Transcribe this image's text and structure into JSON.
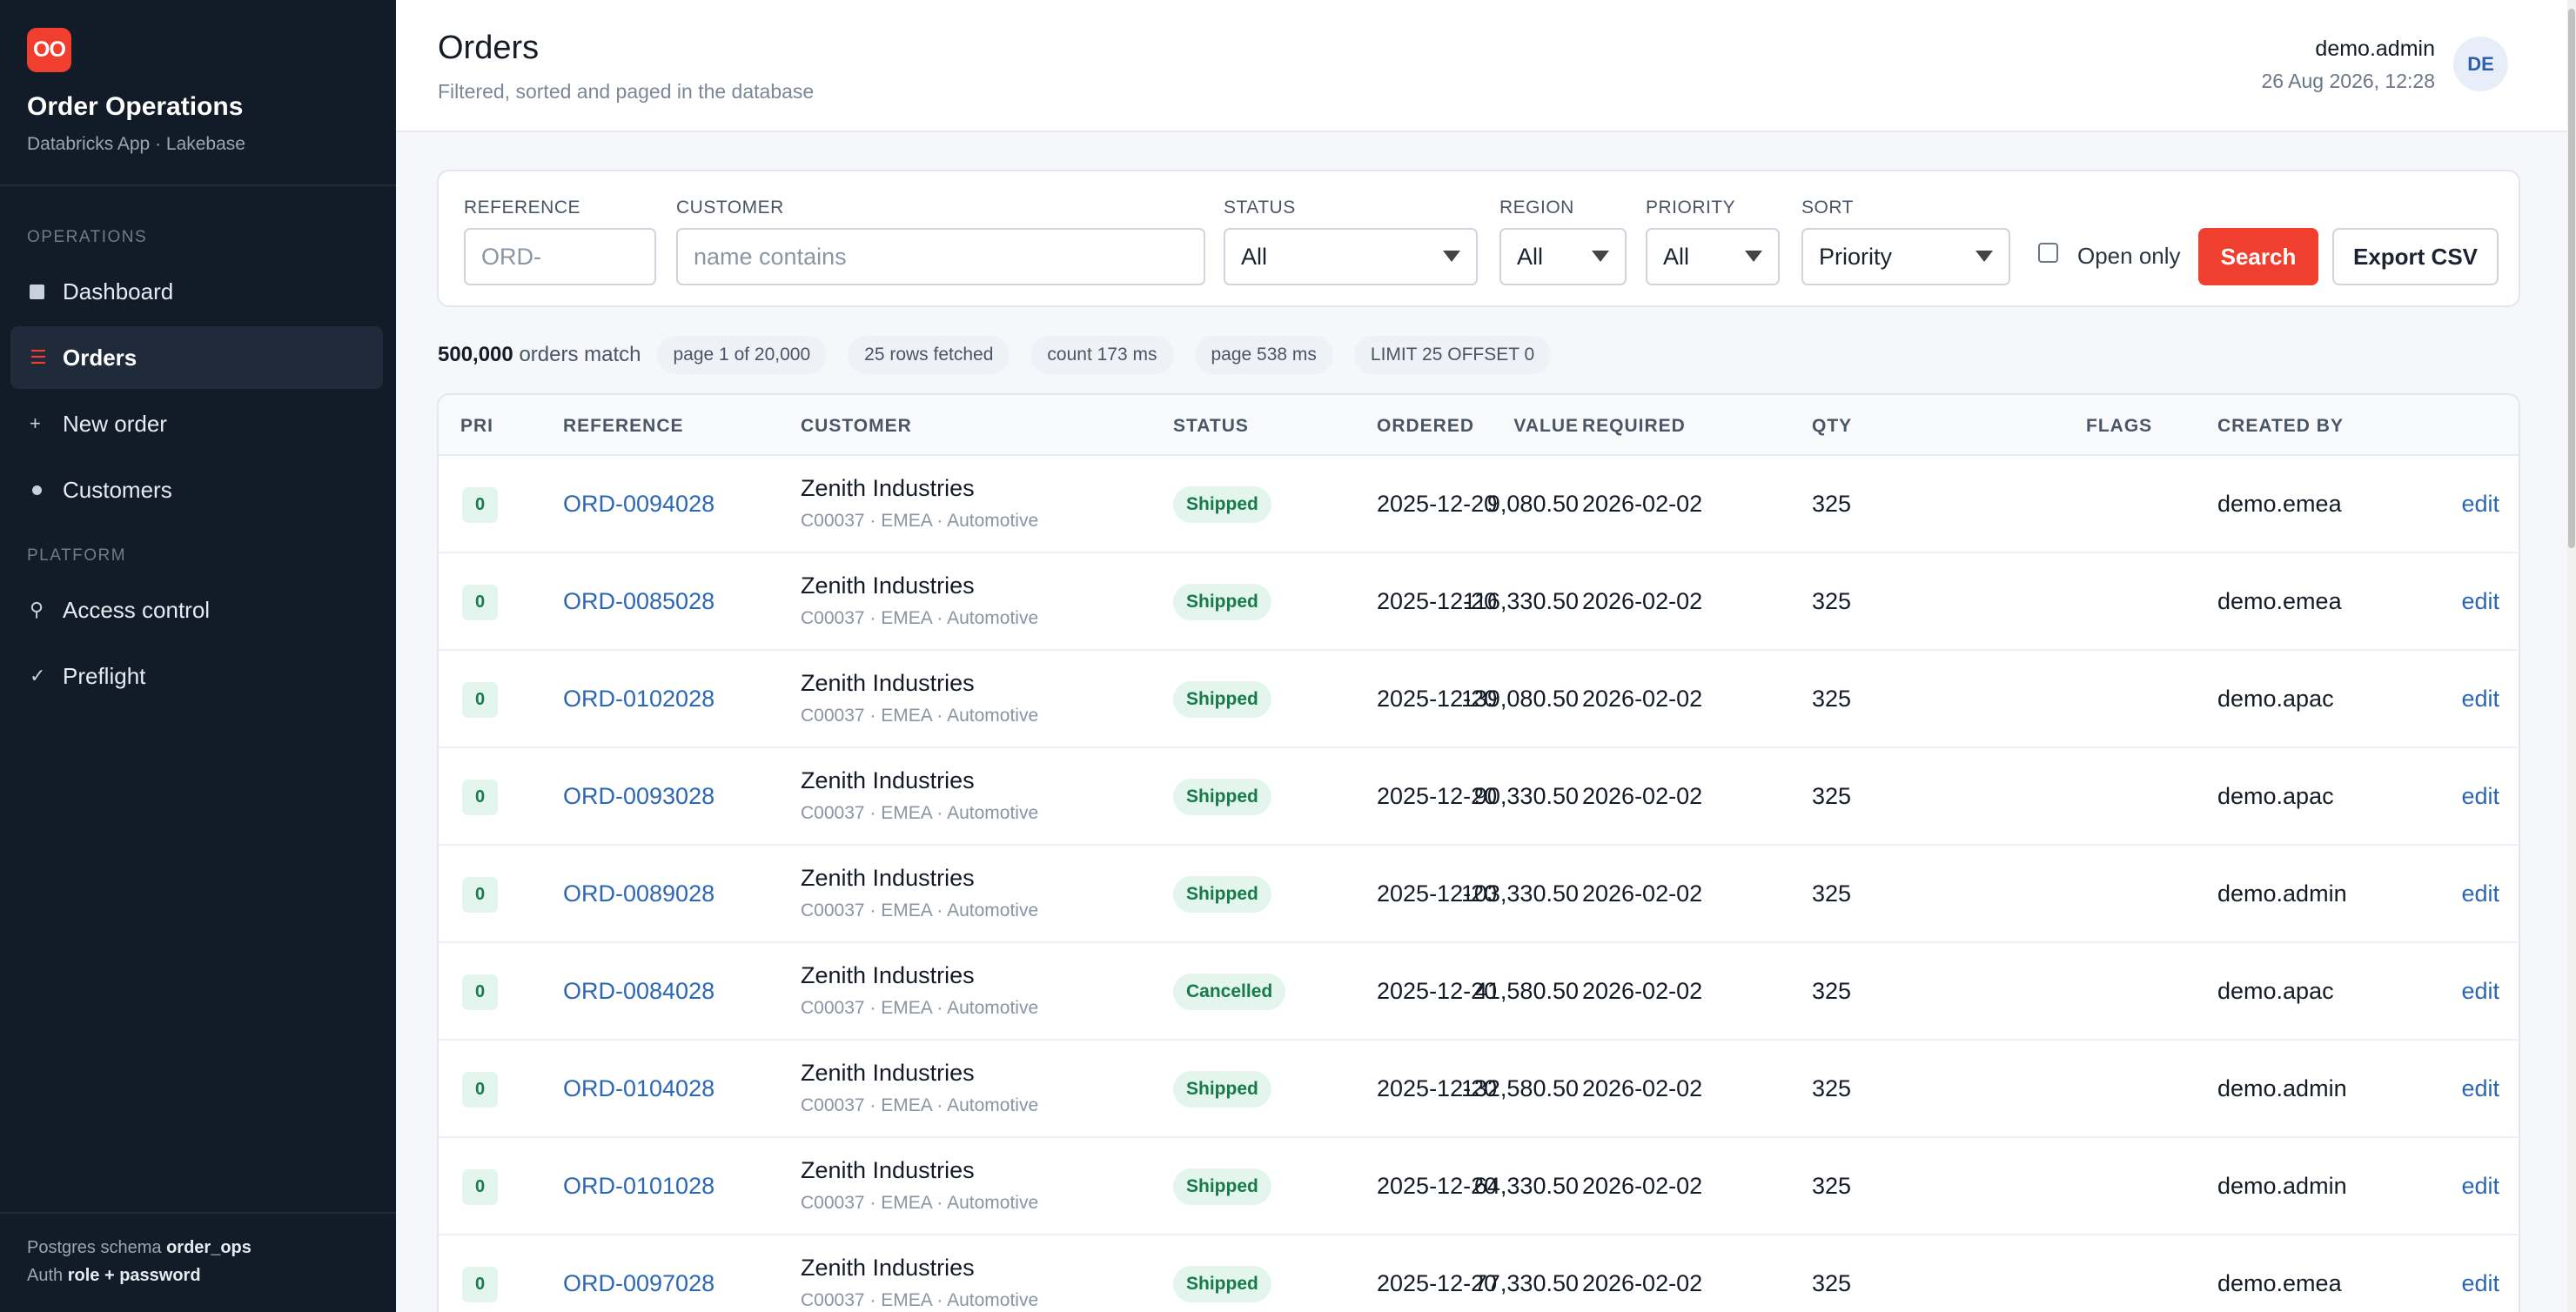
{
  "sidebar": {
    "logo_text": "OO",
    "title": "Order Operations",
    "subtitle": "Databricks App · Lakebase",
    "section_operations": "OPERATIONS",
    "section_platform": "PLATFORM",
    "items": [
      {
        "label": "Dashboard",
        "icon": "square-icon"
      },
      {
        "label": "Orders",
        "icon": "list-icon",
        "active": true
      },
      {
        "label": "New order",
        "icon": "plus-icon"
      },
      {
        "label": "Customers",
        "icon": "dot-icon"
      },
      {
        "label": "Access control",
        "icon": "key-icon"
      },
      {
        "label": "Preflight",
        "icon": "check-icon"
      }
    ],
    "footer": {
      "schema_prefix": "Postgres schema",
      "schema_value": "order_ops",
      "auth_prefix": "Auth",
      "auth_value": "role + password"
    }
  },
  "header": {
    "title": "Orders",
    "subtitle": "Filtered, sorted and paged in the database",
    "user": "demo.admin",
    "datetime": "26 Aug 2026, 12:28",
    "avatar": "DE"
  },
  "filters": {
    "reference": {
      "label": "REFERENCE",
      "placeholder": "ORD-",
      "value": ""
    },
    "customer": {
      "label": "CUSTOMER",
      "placeholder": "name contains",
      "value": ""
    },
    "status": {
      "label": "STATUS",
      "value": "All"
    },
    "region": {
      "label": "REGION",
      "value": "All"
    },
    "priority": {
      "label": "PRIORITY",
      "value": "All"
    },
    "sort": {
      "label": "SORT",
      "value": "Priority"
    },
    "open_only_label": "Open only",
    "open_only_checked": false,
    "search_label": "Search",
    "export_label": "Export CSV"
  },
  "stats": {
    "count": "500,000",
    "count_suffix": "orders match",
    "pills": [
      "page 1 of 20,000",
      "25 rows fetched",
      "count 173 ms",
      "page 538 ms",
      "LIMIT 25 OFFSET 0"
    ]
  },
  "table": {
    "columns": [
      "PRI",
      "REFERENCE",
      "CUSTOMER",
      "STATUS",
      "ORDERED",
      "REQUIRED",
      "QTY",
      "VALUE",
      "FLAGS",
      "CREATED BY"
    ],
    "edit_label": "edit",
    "rows": [
      {
        "pri": "0",
        "ref": "ORD-0094028",
        "customer": "Zenith Industries",
        "meta": "C00037 · EMEA · Automotive",
        "status": "Shipped",
        "ordered": "2025-12-20",
        "required": "2026-02-02",
        "qty": "325",
        "value": "9,080.50",
        "flags": "",
        "created_by": "demo.emea"
      },
      {
        "pri": "0",
        "ref": "ORD-0085028",
        "customer": "Zenith Industries",
        "meta": "C00037 · EMEA · Automotive",
        "status": "Shipped",
        "ordered": "2025-12-20",
        "required": "2026-02-02",
        "qty": "325",
        "value": "116,330.50",
        "flags": "",
        "created_by": "demo.emea"
      },
      {
        "pri": "0",
        "ref": "ORD-0102028",
        "customer": "Zenith Industries",
        "meta": "C00037 · EMEA · Automotive",
        "status": "Shipped",
        "ordered": "2025-12-20",
        "required": "2026-02-02",
        "qty": "325",
        "value": "139,080.50",
        "flags": "",
        "created_by": "demo.apac"
      },
      {
        "pri": "0",
        "ref": "ORD-0093028",
        "customer": "Zenith Industries",
        "meta": "C00037 · EMEA · Automotive",
        "status": "Shipped",
        "ordered": "2025-12-20",
        "required": "2026-02-02",
        "qty": "325",
        "value": "90,330.50",
        "flags": "",
        "created_by": "demo.apac"
      },
      {
        "pri": "0",
        "ref": "ORD-0089028",
        "customer": "Zenith Industries",
        "meta": "C00037 · EMEA · Automotive",
        "status": "Shipped",
        "ordered": "2025-12-20",
        "required": "2026-02-02",
        "qty": "325",
        "value": "103,330.50",
        "flags": "",
        "created_by": "demo.admin"
      },
      {
        "pri": "0",
        "ref": "ORD-0084028",
        "customer": "Zenith Industries",
        "meta": "C00037 · EMEA · Automotive",
        "status": "Cancelled",
        "ordered": "2025-12-20",
        "required": "2026-02-02",
        "qty": "325",
        "value": "41,580.50",
        "flags": "",
        "created_by": "demo.apac"
      },
      {
        "pri": "0",
        "ref": "ORD-0104028",
        "customer": "Zenith Industries",
        "meta": "C00037 · EMEA · Automotive",
        "status": "Shipped",
        "ordered": "2025-12-20",
        "required": "2026-02-02",
        "qty": "325",
        "value": "132,580.50",
        "flags": "",
        "created_by": "demo.admin"
      },
      {
        "pri": "0",
        "ref": "ORD-0101028",
        "customer": "Zenith Industries",
        "meta": "C00037 · EMEA · Automotive",
        "status": "Shipped",
        "ordered": "2025-12-20",
        "required": "2026-02-02",
        "qty": "325",
        "value": "64,330.50",
        "flags": "",
        "created_by": "demo.admin"
      },
      {
        "pri": "0",
        "ref": "ORD-0097028",
        "customer": "Zenith Industries",
        "meta": "C00037 · EMEA · Automotive",
        "status": "Shipped",
        "ordered": "2025-12-20",
        "required": "2026-02-02",
        "qty": "325",
        "value": "77,330.50",
        "flags": "",
        "created_by": "demo.emea"
      }
    ]
  },
  "colors": {
    "accent": "#f03e2f",
    "sidebar_bg": "#121b28",
    "link": "#2b67b4",
    "status_bg": "#e3f5ec",
    "status_fg": "#177a4c"
  }
}
